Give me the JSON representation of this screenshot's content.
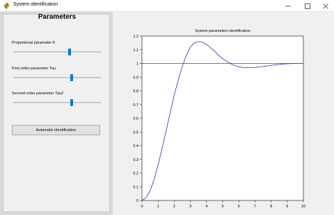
{
  "window": {
    "title": "System identification",
    "icon": "scilab-icon",
    "controls": [
      "minimize-icon",
      "maximize-icon",
      "close-icon"
    ]
  },
  "panel": {
    "title": "Parameters",
    "params": [
      {
        "label": "Proportional parameter K",
        "value": 0.65
      },
      {
        "label": "First order parameter Tau",
        "value": 0.67
      },
      {
        "label": "Second order parameter Tau2",
        "value": 0.67
      }
    ],
    "button_label": "Automatic identification"
  },
  "chart_data": {
    "type": "line",
    "title": "System parameters identification",
    "xlabel": "",
    "ylabel": "",
    "xlim": [
      0,
      10
    ],
    "ylim": [
      0,
      1.2
    ],
    "xticks": [
      "0",
      "1",
      "2",
      "3",
      "4",
      "5",
      "6",
      "7",
      "8",
      "9",
      "10"
    ],
    "yticks": [
      "0",
      "0.1",
      "0.2",
      "0.3",
      "0.4",
      "0.5",
      "0.6",
      "0.7",
      "0.8",
      "0.9",
      "1",
      "1.1",
      "1.2"
    ],
    "grid": false,
    "series": [
      {
        "color": "#2b2bb8",
        "x": [
          0,
          0.25,
          0.5,
          0.75,
          1,
          1.25,
          1.5,
          1.75,
          2,
          2.25,
          2.5,
          2.75,
          3,
          3.25,
          3.5,
          3.75,
          4,
          4.25,
          4.5,
          4.75,
          5,
          5.25,
          5.5,
          5.75,
          6,
          6.25,
          6.5,
          6.75,
          7,
          7.25,
          7.5,
          7.75,
          8,
          8.25,
          8.5,
          8.75,
          9,
          9.25,
          9.5,
          9.75,
          10
        ],
        "y": [
          0,
          0.02,
          0.07,
          0.15,
          0.26,
          0.38,
          0.51,
          0.64,
          0.77,
          0.88,
          0.98,
          1.06,
          1.12,
          1.15,
          1.16,
          1.155,
          1.14,
          1.115,
          1.09,
          1.06,
          1.035,
          1.015,
          0.998,
          0.985,
          0.976,
          0.971,
          0.969,
          0.969,
          0.971,
          0.974,
          0.978,
          0.982,
          0.986,
          0.99,
          0.993,
          0.996,
          0.998,
          0.999,
          1.0,
          1.0,
          1.0
        ]
      },
      {
        "color": "#d01010",
        "x": [
          0,
          10
        ],
        "y": [
          1,
          1
        ]
      }
    ]
  }
}
